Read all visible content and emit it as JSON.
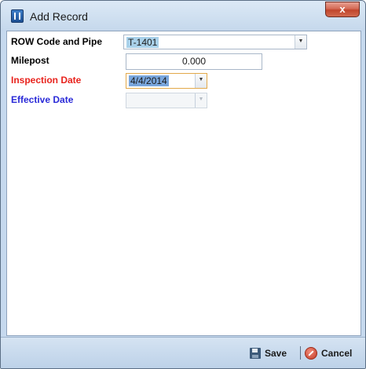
{
  "window": {
    "title": "Add Record",
    "close_glyph": "x"
  },
  "form": {
    "row_code": {
      "label": "ROW Code and Pipe",
      "value": "T-1401",
      "label_color": "#000000"
    },
    "milepost": {
      "label": "Milepost",
      "value": "0.000",
      "label_color": "#000000"
    },
    "inspection_date": {
      "label": "Inspection Date",
      "value": "4/4/2014",
      "label_color": "#e8221c"
    },
    "effective_date": {
      "label": "Effective Date",
      "value": "",
      "label_color": "#2a2ad8"
    }
  },
  "footer": {
    "save_label": "Save",
    "separator": "|",
    "cancel_label": "Cancel"
  },
  "icons": {
    "app": "app-record-icon",
    "save": "floppy-disk-icon",
    "cancel": "cancel-circle-icon",
    "dropdown": "dropdown-arrow-icon"
  },
  "colors": {
    "required_label": "#e8221c",
    "secondary_label": "#2a2ad8",
    "selection": "#a9d1ea",
    "focus_border": "#e3a94a"
  }
}
